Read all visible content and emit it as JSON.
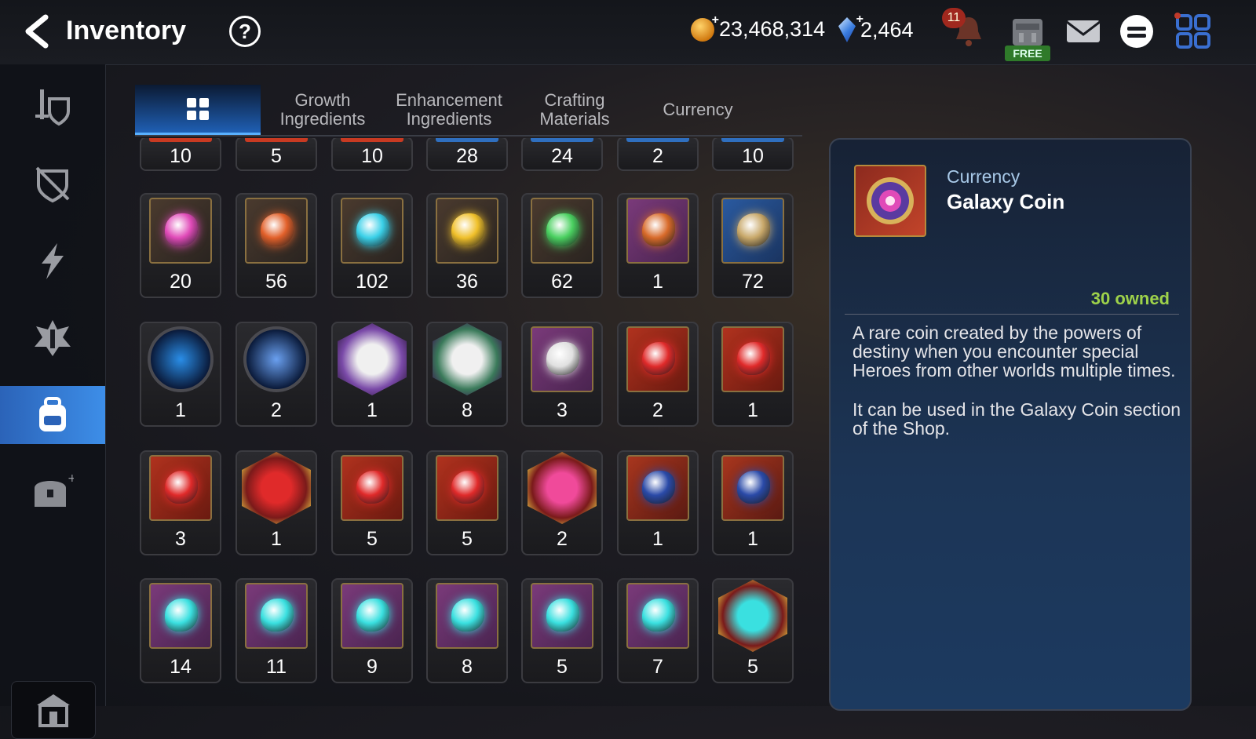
{
  "header": {
    "title": "Inventory",
    "help_label": "?",
    "gold": "23,468,314",
    "crystals": "2,464",
    "notification_count": "11",
    "free_label": "FREE"
  },
  "colors": {
    "accent": "#3d8ee8",
    "owned_green": "#9ed24a",
    "panel_blue": "#1c3556"
  },
  "sidebar": {
    "items": [
      {
        "icon": "sword-shield-icon",
        "active": false
      },
      {
        "icon": "broken-shield-icon",
        "active": false
      },
      {
        "icon": "lightning-icon",
        "active": false
      },
      {
        "icon": "artifact-icon",
        "active": false
      },
      {
        "icon": "backpack-icon",
        "active": true
      },
      {
        "icon": "chest-icon",
        "active": false
      }
    ],
    "bottom_icon": "guild-icon"
  },
  "tabs": [
    {
      "label": "",
      "icon": "grid-icon",
      "active": true
    },
    {
      "label": "Growth\nIngredients",
      "active": false
    },
    {
      "label": "Enhancement\nIngredients",
      "active": false
    },
    {
      "label": "Crafting\nMaterials",
      "active": false
    },
    {
      "label": "Currency",
      "active": false
    }
  ],
  "grid": {
    "partial_row": [
      {
        "qty": "10",
        "color": "#c83a22"
      },
      {
        "qty": "5",
        "color": "#c83a22"
      },
      {
        "qty": "10",
        "color": "#c83a22"
      },
      {
        "qty": "28",
        "color": "#2f6fbf"
      },
      {
        "qty": "24",
        "color": "#2f6fbf"
      },
      {
        "qty": "2",
        "color": "#2f6fbf"
      },
      {
        "qty": "10",
        "color": "#2f6fbf"
      }
    ],
    "rows": [
      [
        {
          "qty": "20",
          "icon": "pink-rune-icon",
          "frame": "brown",
          "color": "#e04ab8"
        },
        {
          "qty": "56",
          "icon": "orange-rune-icon",
          "frame": "brown",
          "color": "#e2602a"
        },
        {
          "qty": "102",
          "icon": "cyan-rune-icon",
          "frame": "brown",
          "color": "#3ad0e8"
        },
        {
          "qty": "36",
          "icon": "gold-rune-icon",
          "frame": "brown",
          "color": "#f0c02a"
        },
        {
          "qty": "62",
          "icon": "green-rune-icon",
          "frame": "brown",
          "color": "#4ad060"
        },
        {
          "qty": "1",
          "icon": "fox-tail-icon",
          "frame": "purple",
          "color": "#d86a2a"
        },
        {
          "qty": "72",
          "icon": "herb-root-icon",
          "frame": "blue",
          "color": "#c8a86a"
        }
      ],
      [
        {
          "qty": "1",
          "icon": "blue-sigil-icon",
          "frame": "round",
          "color": "#2a8ee8"
        },
        {
          "qty": "2",
          "icon": "blue-crystal-icon",
          "frame": "round",
          "color": "#6aa0f0"
        },
        {
          "qty": "1",
          "icon": "pet-food-icon",
          "frame": "hex-purple",
          "color": "#7a4aa8"
        },
        {
          "qty": "8",
          "icon": "pet-food-icon",
          "frame": "hex-purple",
          "color": "#3a7a5a"
        },
        {
          "qty": "3",
          "icon": "feather-wand-icon",
          "frame": "purple",
          "color": "#e0e0e0"
        },
        {
          "qty": "2",
          "icon": "red-gem-sword-icon",
          "frame": "red",
          "color": "#e02a2a"
        },
        {
          "qty": "1",
          "icon": "red-gem-armor-icon",
          "frame": "red",
          "color": "#e02a2a"
        }
      ],
      [
        {
          "qty": "3",
          "icon": "red-gem-necklace-icon",
          "frame": "red",
          "color": "#e02a2a"
        },
        {
          "qty": "1",
          "icon": "red-gem-cross-icon",
          "frame": "hex-gold",
          "color": "#e02a2a"
        },
        {
          "qty": "5",
          "icon": "red-gem-hammer-icon",
          "frame": "red",
          "color": "#e02a2a"
        },
        {
          "qty": "5",
          "icon": "red-gem-blade-icon",
          "frame": "red",
          "color": "#e02a2a"
        },
        {
          "qty": "2",
          "icon": "potion-icon",
          "frame": "hex-gold",
          "color": "#f04a9a"
        },
        {
          "qty": "1",
          "icon": "blue-gem-hammer-icon",
          "frame": "red-blue",
          "color": "#2a4aa8"
        },
        {
          "qty": "1",
          "icon": "blue-gem-sword-icon",
          "frame": "red-blue",
          "color": "#2a4aa8"
        }
      ],
      [
        {
          "qty": "14",
          "icon": "dark-gem-sword-icon",
          "frame": "purple",
          "color": "#3ae0e0"
        },
        {
          "qty": "11",
          "icon": "dark-gem-spiral-icon",
          "frame": "purple",
          "color": "#3ae0e0"
        },
        {
          "qty": "9",
          "icon": "dark-gem-armor-icon",
          "frame": "purple",
          "color": "#3ae0e0"
        },
        {
          "qty": "8",
          "icon": "dark-gem-boot-icon",
          "frame": "purple",
          "color": "#3ae0e0"
        },
        {
          "qty": "5",
          "icon": "dark-gem-ring-icon",
          "frame": "purple",
          "color": "#3ae0e0"
        },
        {
          "qty": "7",
          "icon": "dark-gem-necklace-icon",
          "frame": "purple",
          "color": "#3ae0e0"
        },
        {
          "qty": "5",
          "icon": "dark-gem-cross-icon",
          "frame": "hex-gold",
          "color": "#3ae0e0"
        }
      ]
    ]
  },
  "detail": {
    "category": "Currency",
    "name": "Galaxy Coin",
    "owned": "30 owned",
    "desc1": "A rare coin created by the powers of destiny when you encounter special Heroes from other worlds multiple times.",
    "desc2": "It can be used in the Galaxy Coin section of the Shop.",
    "icon": "galaxy-coin-icon"
  }
}
